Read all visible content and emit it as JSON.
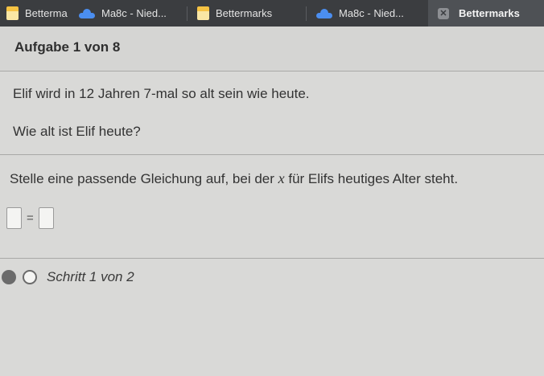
{
  "tabs": [
    {
      "label": "Betterma",
      "icon": "bettermarks-icon",
      "active": false
    },
    {
      "label": "Ma8c - Nied...",
      "icon": "cloud-icon",
      "active": false
    },
    {
      "label": "Bettermarks",
      "icon": "bettermarks-icon",
      "active": false
    },
    {
      "label": "Ma8c - Nied...",
      "icon": "cloud-icon",
      "active": false
    },
    {
      "label": "Bettermarks",
      "icon": "close-icon",
      "active": true
    }
  ],
  "header": {
    "title": "Aufgabe 1 von 8"
  },
  "question": {
    "line1": "Elif wird in 12 Jahren 7-mal so alt sein wie heute.",
    "line2": "Wie alt ist Elif heute?"
  },
  "task": {
    "instruction_before": "Stelle eine passende Gleichung auf, bei der ",
    "variable": "x",
    "instruction_after": " für Elifs heutiges Alter steht.",
    "equals": "="
  },
  "progress": {
    "label": "Schritt 1 von 2",
    "current_step": 1,
    "total_steps": 2
  },
  "colors": {
    "tabbar": "#3b3d40",
    "background": "#d9d9d7",
    "accent_bookmark": "#f6c343",
    "cloud": "#4b8ef0"
  }
}
